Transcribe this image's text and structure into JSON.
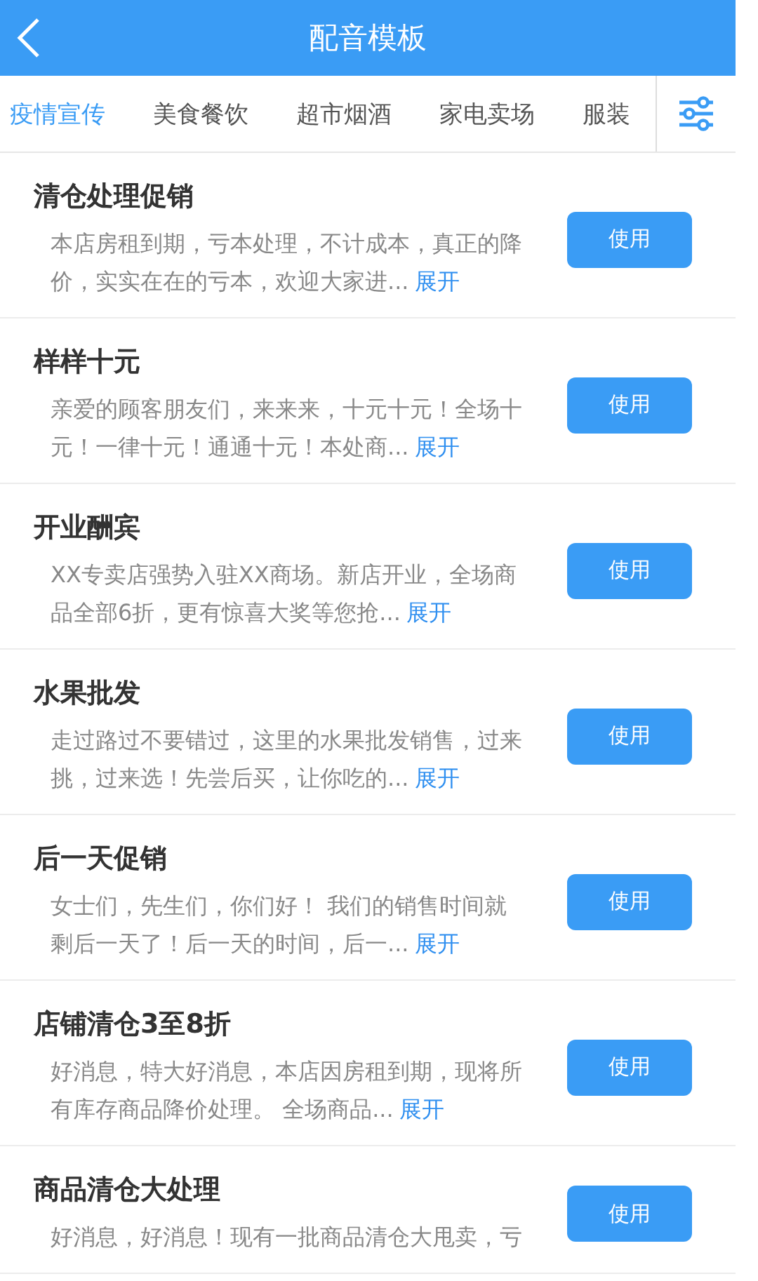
{
  "header": {
    "title": "配音模板"
  },
  "tabs": [
    {
      "label": "疫情宣传",
      "selected": true
    },
    {
      "label": "美食餐饮",
      "selected": false
    },
    {
      "label": "超市烟酒",
      "selected": false
    },
    {
      "label": "家电卖场",
      "selected": false
    },
    {
      "label": "服装",
      "selected": false
    }
  ],
  "templates": [
    {
      "title": "清仓处理促销",
      "description": "本店房租到期，亏本处理，不计成本，真正的降价，实实在在的亏本，欢迎大家进...",
      "more": "展开",
      "button": "使用"
    },
    {
      "title": "样样十元",
      "description": "亲爱的顾客朋友们，来来来，十元十元！全场十元！一律十元！通通十元！本处商...",
      "more": "展开",
      "button": "使用"
    },
    {
      "title": "开业酬宾",
      "description": "XX专卖店强势入驻XX商场。新店开业，全场商品全部6折，更有惊喜大奖等您抢...",
      "more": "展开",
      "button": "使用"
    },
    {
      "title": "水果批发",
      "description": "走过路过不要错过，这里的水果批发销售，过来挑，过来选！先尝后买，让你吃的...",
      "more": "展开",
      "button": "使用"
    },
    {
      "title": "后一天促销",
      "description": "女士们，先生们，你们好！ 我们的销售时间就剩后一天了！后一天的时间，后一...",
      "more": "展开",
      "button": "使用"
    },
    {
      "title": "店铺清仓3至8折",
      "description": "好消息，特大好消息，本店因房租到期，现将所有库存商品降价处理。 全场商品...",
      "more": "展开",
      "button": "使用"
    },
    {
      "title": "商品清仓大处理",
      "description": "好消息，好消息！现有一批商品清仓大甩卖，亏",
      "button": "使用"
    }
  ]
}
